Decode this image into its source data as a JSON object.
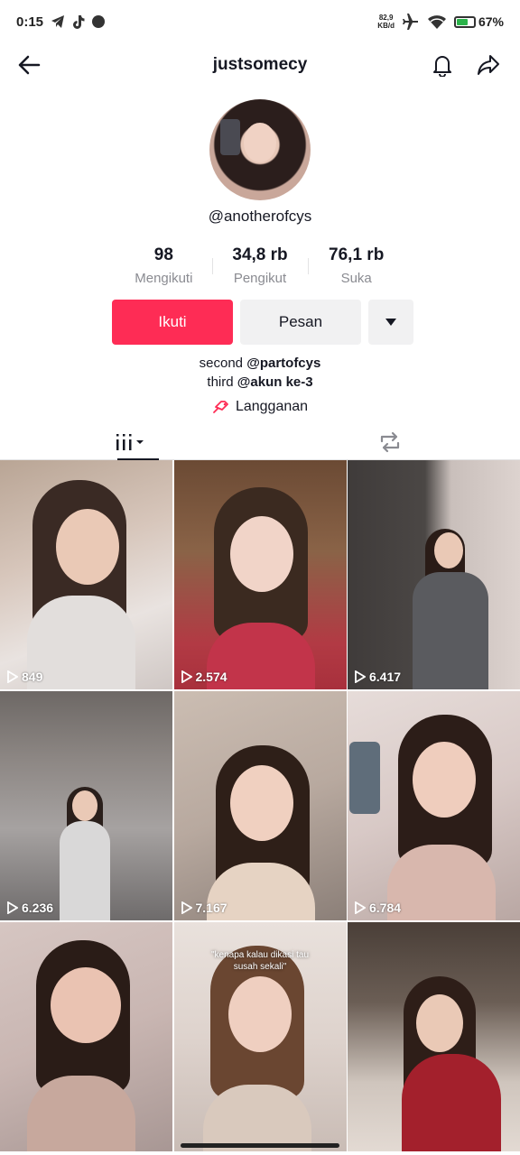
{
  "status_bar": {
    "time": "0:15",
    "net_speed_value": "82,9",
    "net_speed_unit": "KB/d",
    "battery": "67%",
    "battery_level": 0.67,
    "icons": [
      "telegram-icon",
      "tiktok-icon",
      "dot-icon",
      "airplane-icon",
      "wifi-icon",
      "battery-icon"
    ]
  },
  "header": {
    "title": "justsomecy",
    "icons": [
      "back-arrow-icon",
      "bell-icon",
      "share-icon"
    ]
  },
  "profile": {
    "handle": "@anotherofcys",
    "stats": [
      {
        "value": "98",
        "label": "Mengikuti"
      },
      {
        "value": "34,8 rb",
        "label": "Pengikut"
      },
      {
        "value": "76,1 rb",
        "label": "Suka"
      }
    ],
    "buttons": {
      "follow": "Ikuti",
      "message": "Pesan"
    },
    "bio": {
      "line1_prefix": "second ",
      "line1_mention": "@partofcys",
      "line2_prefix": "third ",
      "line2_mention": "@akun ke-3"
    },
    "subscription": "Langganan"
  },
  "tabs": [
    "videos-grid-icon",
    "repost-icon"
  ],
  "videos": [
    {
      "views": "849"
    },
    {
      "views": "2.574"
    },
    {
      "views": "6.417"
    },
    {
      "views": "6.236"
    },
    {
      "views": "7.167"
    },
    {
      "views": "6.784"
    },
    {
      "views": ""
    },
    {
      "views": "",
      "caption": "\"kenapa kalau dikasi tau susah sekali\""
    },
    {
      "views": ""
    }
  ],
  "colors": {
    "accent": "#fe2c55",
    "secondary_button": "#f1f1f2",
    "muted_text": "#8a8b91",
    "text": "#161823"
  }
}
